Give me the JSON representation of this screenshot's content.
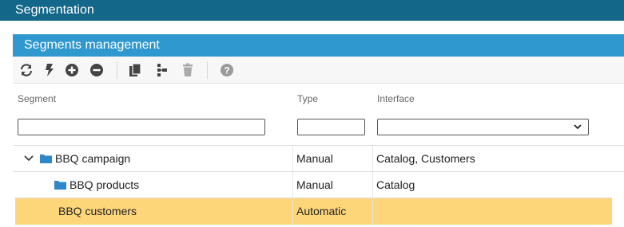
{
  "window": {
    "title": "Segmentation"
  },
  "panel": {
    "title": "Segments management"
  },
  "toolbar": {
    "icons": [
      "refresh-icon",
      "lightning-icon",
      "add-circle-icon",
      "remove-circle-icon",
      "copy-icon",
      "hierarchy-icon",
      "trash-icon",
      "help-icon"
    ]
  },
  "columns": {
    "segment": "Segment",
    "type": "Type",
    "interface": "Interface"
  },
  "filters": {
    "segment": "",
    "type": "",
    "interface": ""
  },
  "rows": [
    {
      "segment": "BBQ campaign",
      "type": "Manual",
      "interface": "Catalog, Customers",
      "expanded": true
    },
    {
      "segment": "BBQ products",
      "type": "Manual",
      "interface": "Catalog"
    },
    {
      "segment": "BBQ customers",
      "type": "Automatic",
      "interface": "",
      "selected": true
    }
  ],
  "colors": {
    "titlebar": "#136788",
    "panel_header": "#2f98cf",
    "selected_row": "#fdd67a",
    "folder": "#2f86c8"
  }
}
